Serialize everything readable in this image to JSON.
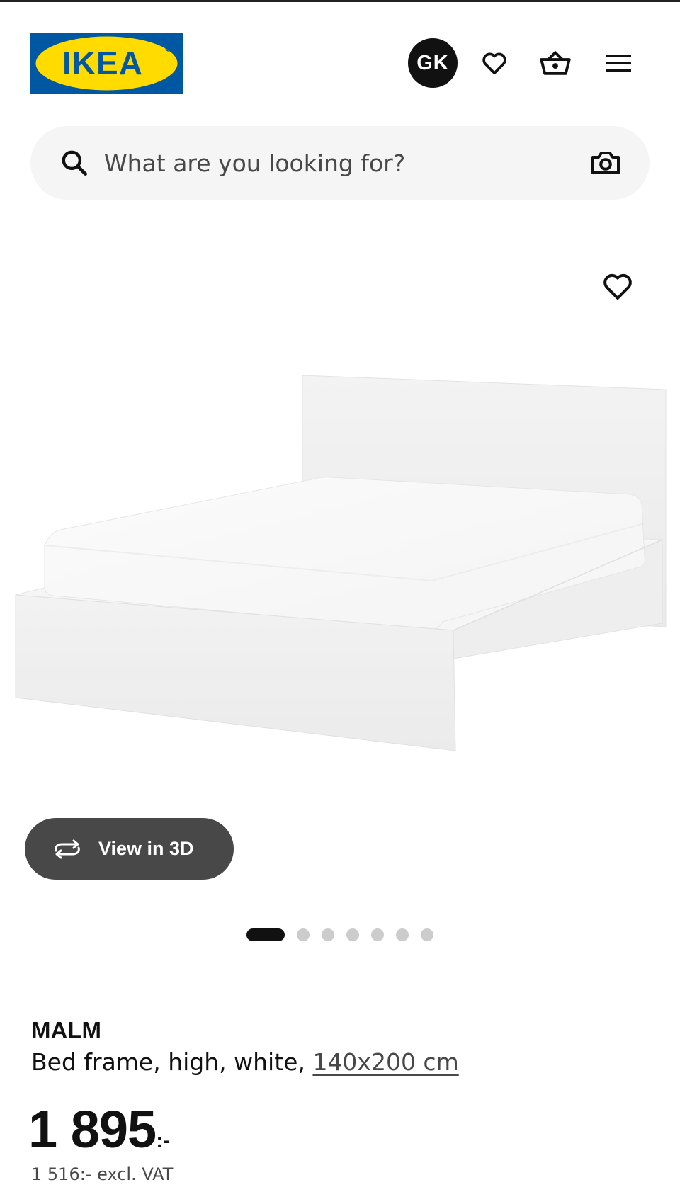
{
  "header": {
    "logo_text": "IKEA",
    "brand_colors": {
      "blue": "#0058a3",
      "yellow": "#ffdb00"
    },
    "avatar_initials": "GK",
    "icons": [
      "heart-icon",
      "shopping-basket-icon",
      "hamburger-menu-icon"
    ]
  },
  "search": {
    "placeholder": "What are you looking for?",
    "value": "",
    "left_icon": "search-icon",
    "right_icon": "camera-icon"
  },
  "gallery": {
    "favourite_icon": "heart-icon",
    "view_3d_label": "View in 3D",
    "view_3d_icon": "rotate-arrows-icon",
    "dots_total": 7,
    "dots_active_index": 0
  },
  "product": {
    "name": "MALM",
    "description": "Bed frame, high, white, ",
    "size_link": "140x200 cm",
    "price": "1 895",
    "price_suffix": ":-",
    "price_excl_vat": "1 516:- excl. VAT"
  }
}
